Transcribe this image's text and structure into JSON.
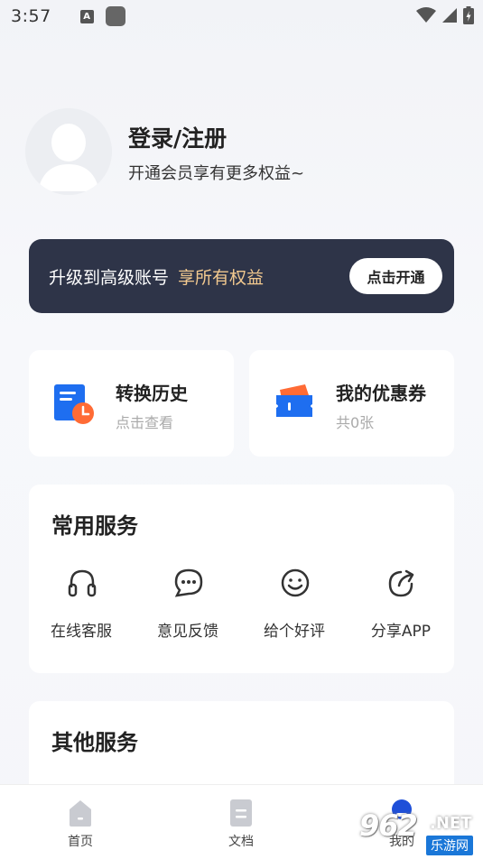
{
  "status_bar": {
    "time": "3:57",
    "notification_letter": "A"
  },
  "profile": {
    "title": "登录/注册",
    "subtitle": "开通会员享有更多权益~"
  },
  "vip_banner": {
    "text": "升级到高级账号",
    "highlight": "享所有权益",
    "button_label": "点击开通",
    "background_color": "#2e3448",
    "highlight_color": "#f2c98f"
  },
  "cards": {
    "history": {
      "title": "转换历史",
      "subtitle": "点击查看",
      "icon": "history-doc-icon"
    },
    "coupon": {
      "title": "我的优惠券",
      "subtitle": "共0张",
      "icon": "coupon-icon"
    }
  },
  "services": {
    "title": "常用服务",
    "items": [
      {
        "label": "在线客服",
        "icon": "headphones-icon"
      },
      {
        "label": "意见反馈",
        "icon": "chat-bubble-icon"
      },
      {
        "label": "给个好评",
        "icon": "smiley-icon"
      },
      {
        "label": "分享APP",
        "icon": "share-icon"
      }
    ]
  },
  "other_services": {
    "title": "其他服务"
  },
  "bottom_nav": {
    "items": [
      {
        "label": "首页",
        "icon": "home-icon"
      },
      {
        "label": "文档",
        "icon": "document-icon"
      },
      {
        "label": "我的",
        "icon": "profile-icon",
        "active": true
      }
    ]
  },
  "watermark": {
    "number": "962",
    "domain": ".NET",
    "name": "乐游网"
  }
}
